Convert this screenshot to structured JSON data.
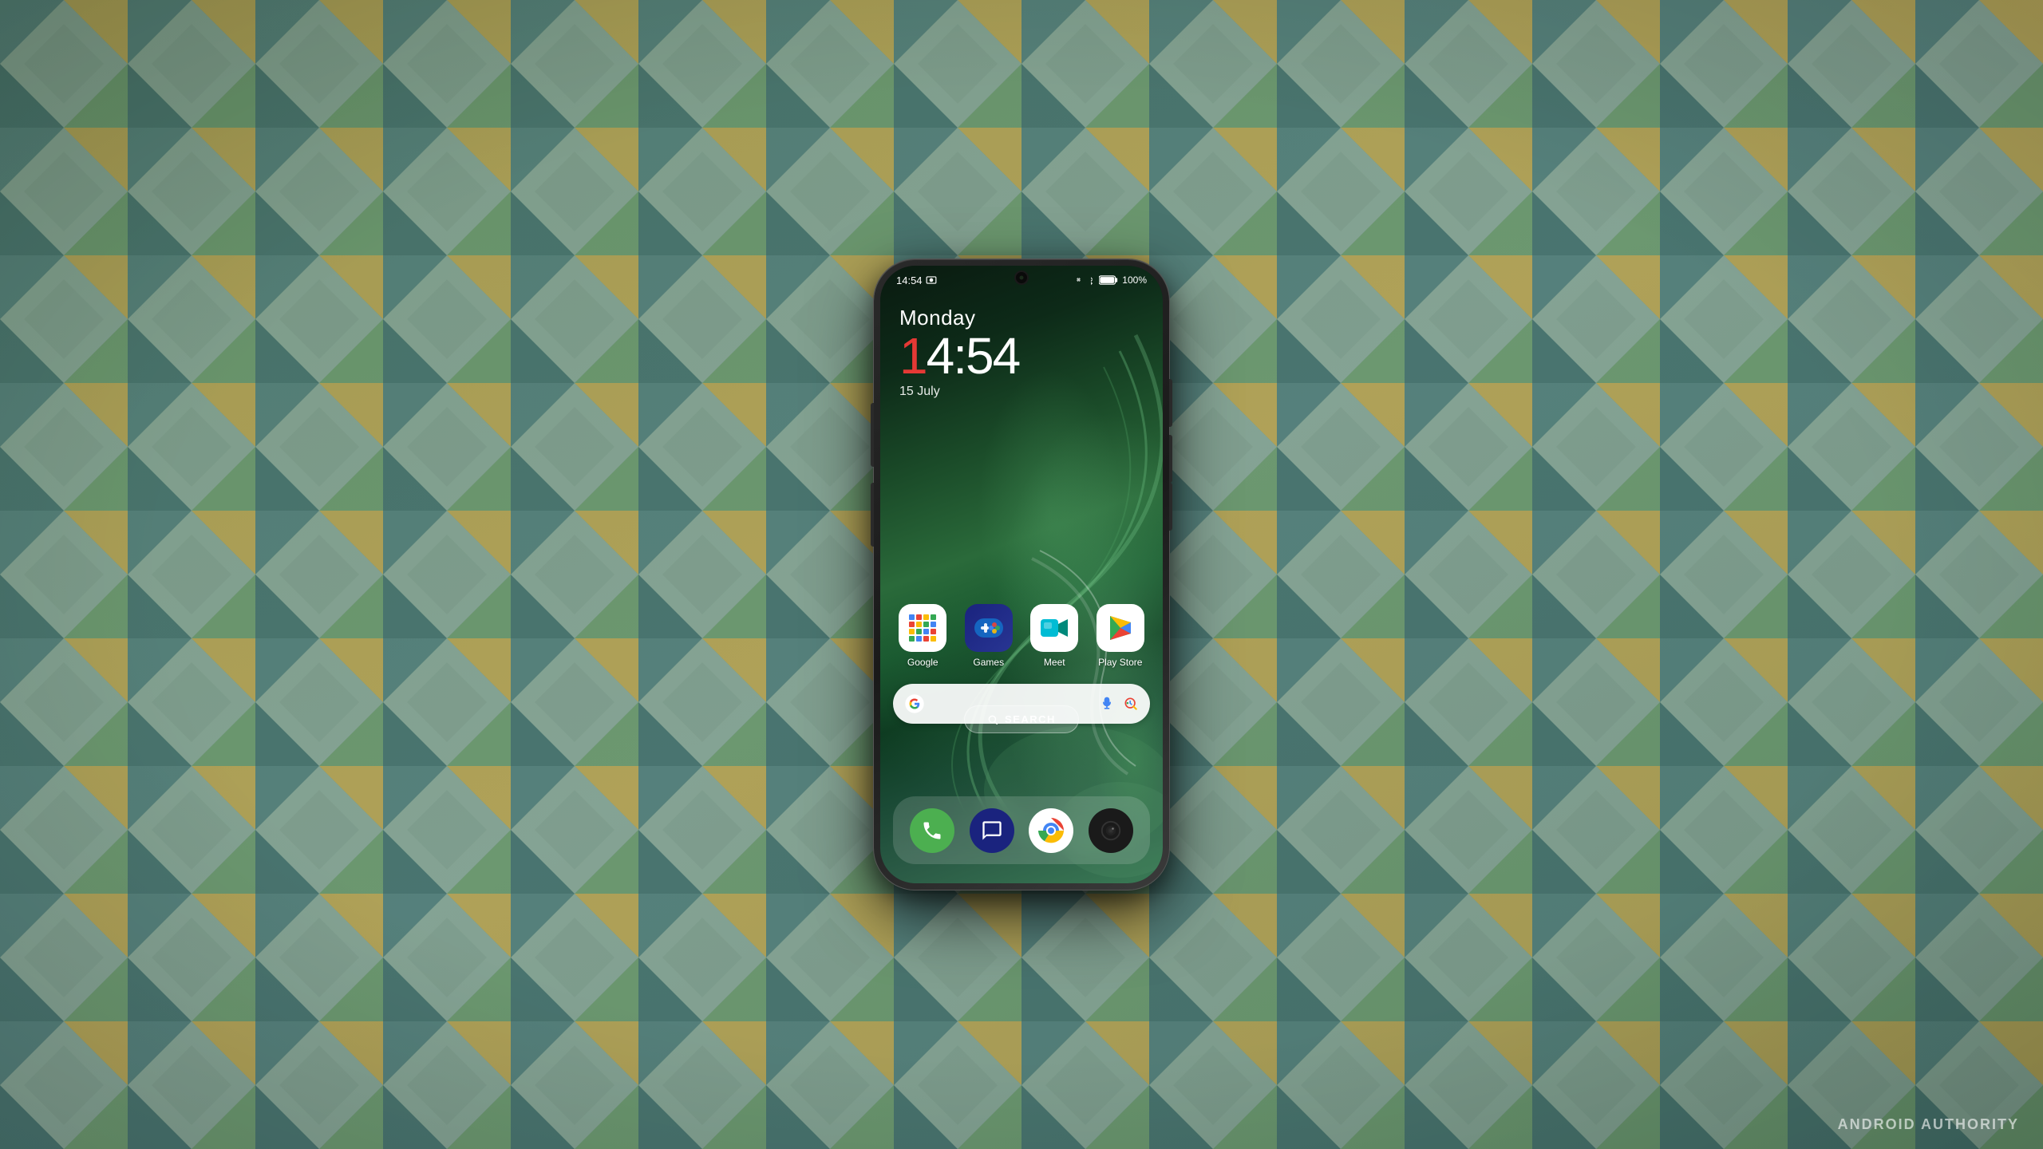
{
  "background": {
    "alt": "Geometric fabric pattern background"
  },
  "phone": {
    "status_bar": {
      "time": "14:54",
      "battery_percent": "100%",
      "icons": [
        "silent-icon",
        "bluetooth-icon",
        "battery-icon"
      ]
    },
    "datetime": {
      "day": "Monday",
      "time_prefix_red": "1",
      "time_rest": "4:54",
      "date": "15 July"
    },
    "search_bar": {
      "placeholder": "Search",
      "google_g": "G",
      "mic_label": "mic-icon",
      "lens_label": "lens-icon"
    },
    "apps": [
      {
        "id": "google",
        "label": "Google",
        "icon_type": "google"
      },
      {
        "id": "games",
        "label": "Games",
        "icon_type": "games"
      },
      {
        "id": "meet",
        "label": "Meet",
        "icon_type": "meet"
      },
      {
        "id": "playstore",
        "label": "Play Store",
        "icon_type": "playstore"
      }
    ],
    "search_button": {
      "label": "SEARCH",
      "icon": "search-icon"
    },
    "dock": [
      {
        "id": "phone",
        "label": "Phone",
        "icon_type": "phone"
      },
      {
        "id": "messages",
        "label": "Messages",
        "icon_type": "messages"
      },
      {
        "id": "chrome",
        "label": "Chrome",
        "icon_type": "chrome"
      },
      {
        "id": "camera",
        "label": "Camera",
        "icon_type": "camera"
      }
    ]
  },
  "watermark": {
    "text": "ANDROID AUTHORITY"
  }
}
